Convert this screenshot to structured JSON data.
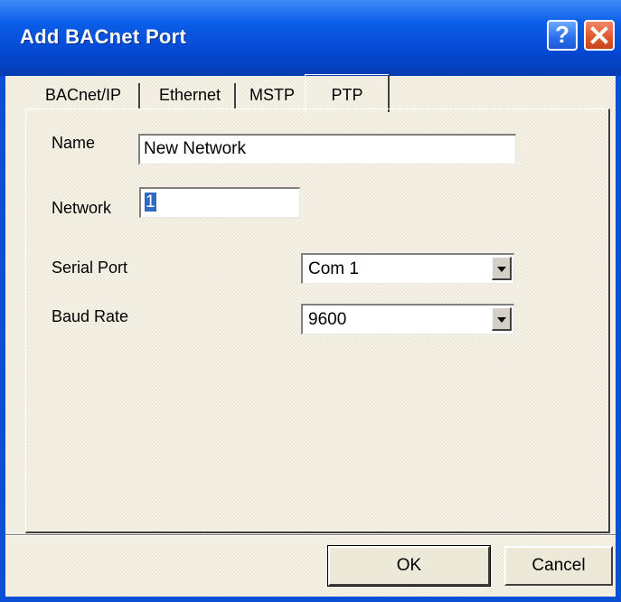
{
  "window": {
    "title": "Add BACnet Port",
    "help_glyph": "?",
    "colors": {
      "titlebar": "#0447d2",
      "close": "#e05a2e",
      "face": "#ece9d8",
      "selection": "#316ac5"
    }
  },
  "tabs": [
    {
      "label": "BACnet/IP"
    },
    {
      "label": "Ethernet"
    },
    {
      "label": "MSTP"
    },
    {
      "label": "PTP",
      "active": true
    }
  ],
  "form": {
    "name": {
      "label": "Name",
      "value": "New Network"
    },
    "network": {
      "label": "Network",
      "value": "1"
    },
    "serial_port": {
      "label": "Serial Port",
      "value": "Com 1"
    },
    "baud_rate": {
      "label": "Baud Rate",
      "value": "9600"
    }
  },
  "buttons": {
    "ok": "OK",
    "cancel": "Cancel"
  }
}
